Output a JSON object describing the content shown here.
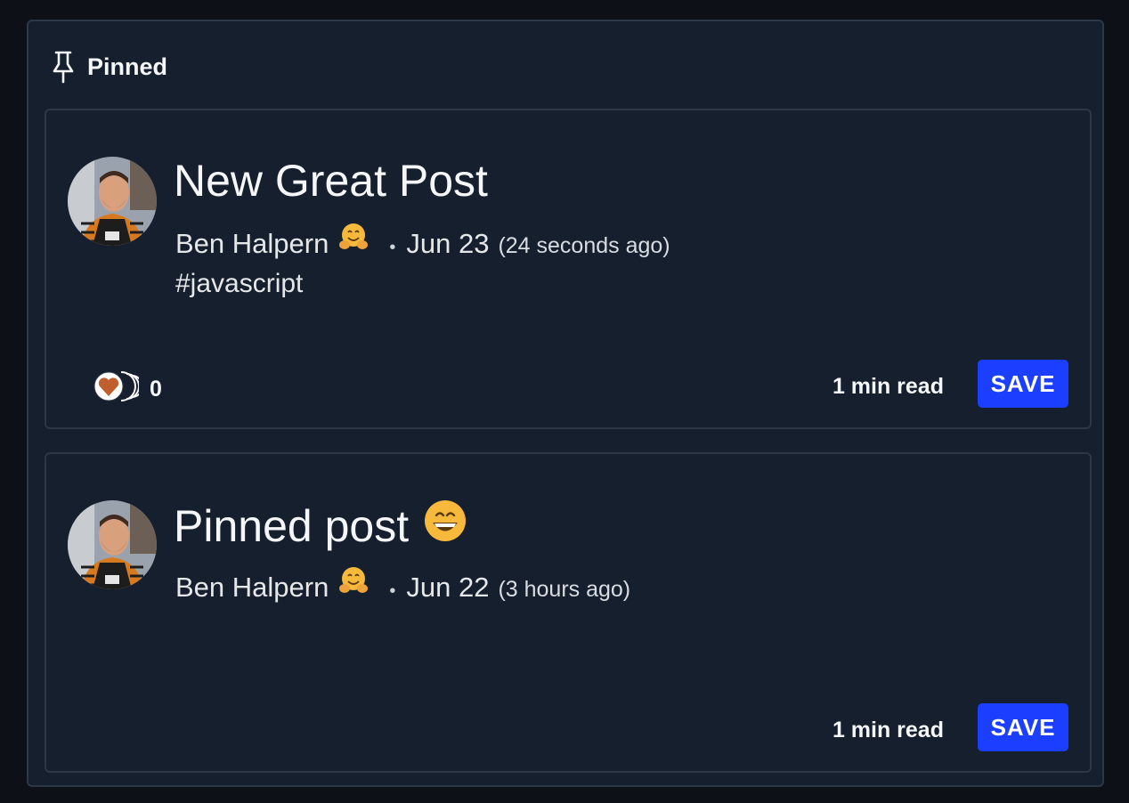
{
  "pinned": {
    "title": "Pinned",
    "icon": "pin-icon"
  },
  "posts": [
    {
      "title": "New Great Post",
      "title_emoji": "",
      "author": "Ben Halpern",
      "author_emoji": "hugging-face-emoji",
      "date": "Jun 23",
      "ago": "(24 seconds ago)",
      "tag": "#javascript",
      "reaction_count": "0",
      "read_time": "1 min read",
      "save_label": "SAVE"
    },
    {
      "title": "Pinned post",
      "title_emoji": "grinning-face-emoji",
      "author": "Ben Halpern",
      "author_emoji": "hugging-face-emoji",
      "date": "Jun 22",
      "ago": "(3 hours ago)",
      "read_time": "1 min read",
      "save_label": "SAVE"
    }
  ],
  "colors": {
    "background": "#0d1117",
    "panel": "#151f2d",
    "border": "#2c3748",
    "text": "#f5f6f7",
    "save_button": "#1c3fff",
    "heart": "#c05f2e"
  }
}
